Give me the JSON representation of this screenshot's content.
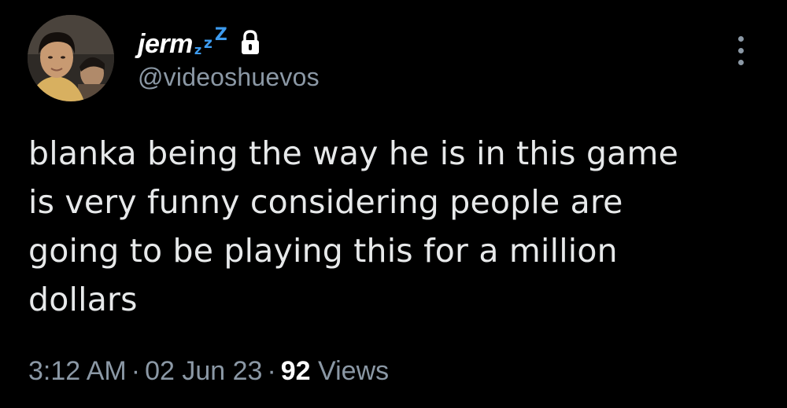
{
  "user": {
    "display_name": "jerm",
    "status_glyphs": [
      "z",
      "z",
      "Z"
    ],
    "lock_icon": "lock-icon",
    "handle": "@videoshuevos",
    "avatar_icon": "profile-photo"
  },
  "menu": {
    "more_icon": "more-vertical-icon"
  },
  "tweet": {
    "lines": [
      "blanka being the way he is in this game",
      "is very funny considering people are",
      "going to be playing this for a million",
      "dollars"
    ]
  },
  "meta": {
    "time": "3:12 AM",
    "separator": "·",
    "date": "02 Jun 23",
    "views_count": "92",
    "views_label": "Views"
  },
  "colors": {
    "background": "#000000",
    "text_primary": "#e7e9ea",
    "text_secondary": "#8b98a5",
    "zzz_accent": "#3d9bef"
  }
}
